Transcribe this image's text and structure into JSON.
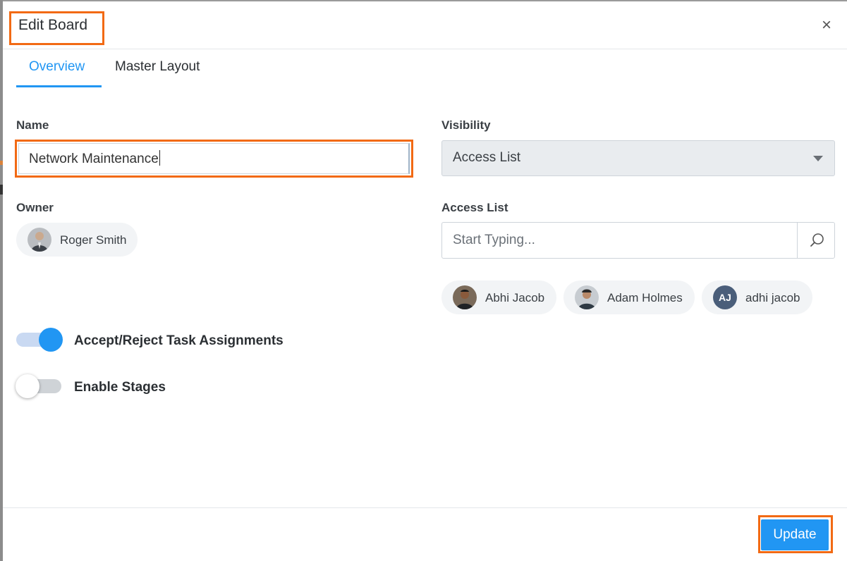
{
  "dialog": {
    "title": "Edit Board",
    "close_glyph": "×"
  },
  "tabs": [
    {
      "label": "Overview",
      "active": true
    },
    {
      "label": "Master Layout",
      "active": false
    }
  ],
  "form": {
    "name_label": "Name",
    "name_value": "Network Maintenance",
    "visibility_label": "Visibility",
    "visibility_value": "Access List",
    "owner_label": "Owner",
    "owner_name": "Roger Smith",
    "access_list_label": "Access List",
    "access_search_placeholder": "Start Typing...",
    "access_members": [
      {
        "name": "Abhi Jacob",
        "avatar": "photo"
      },
      {
        "name": "Adam Holmes",
        "avatar": "photo"
      },
      {
        "name": "adhi jacob",
        "avatar": "initials",
        "initials": "AJ"
      }
    ]
  },
  "toggles": [
    {
      "label": "Accept/Reject Task Assignments",
      "on": true
    },
    {
      "label": "Enable Stages",
      "on": false
    }
  ],
  "footer": {
    "update_label": "Update"
  },
  "colors": {
    "accent": "#2196f3",
    "highlight": "#f26a14",
    "initials_avatar": "#4a5e7a"
  },
  "icons": {
    "close": "close-icon",
    "select_caret": "caret-down-icon",
    "search": "search-icon"
  }
}
